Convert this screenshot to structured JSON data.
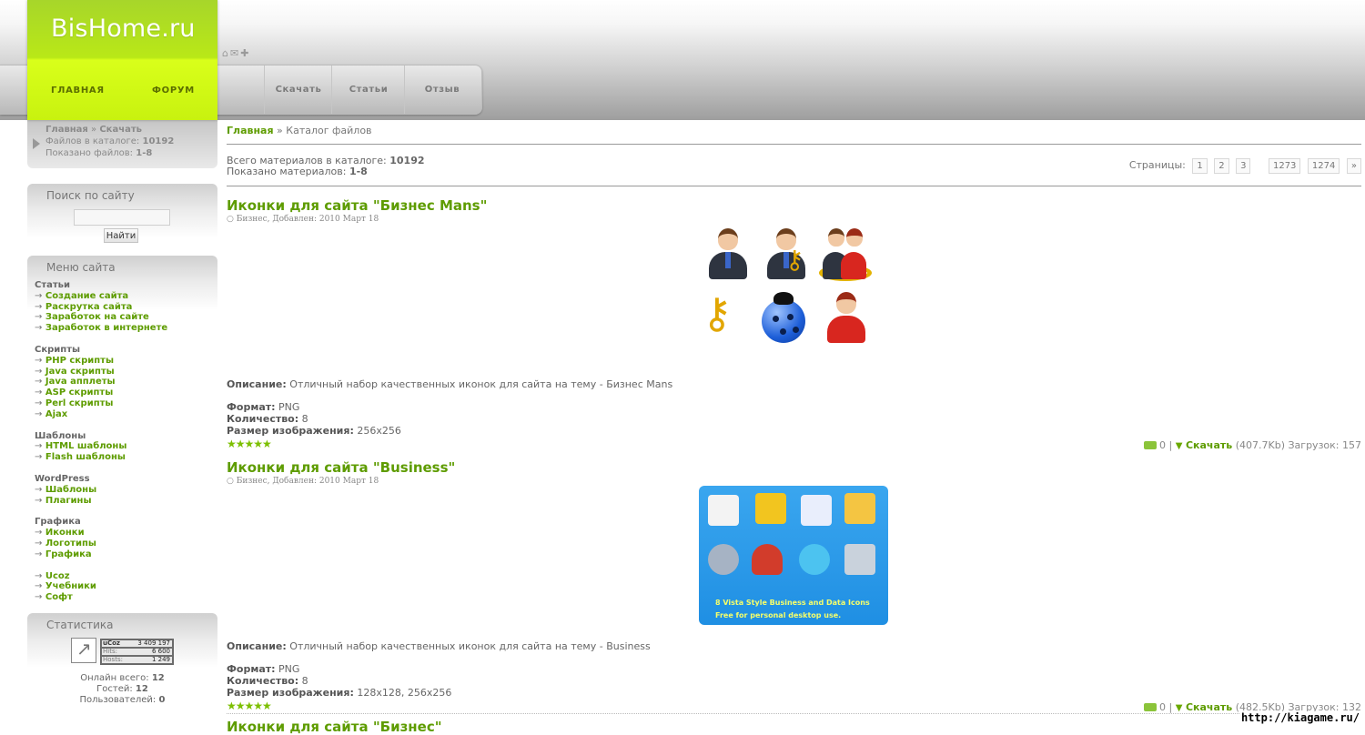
{
  "site": {
    "logo": "BisHome.ru",
    "logo_nav": [
      "ГЛАВНАЯ",
      "ФОРУМ"
    ],
    "quick_icons": [
      "home-icon",
      "mail-icon",
      "add-icon"
    ],
    "nav": [
      "Скачать",
      "Статьи",
      "Отзыв"
    ]
  },
  "crumb_block": {
    "home": "Главная",
    "separator": " » ",
    "current": "Скачать",
    "files_label": "Файлов в каталоге:",
    "files_value": "10192",
    "shown_label": "Показано файлов:",
    "shown_value": "1-8"
  },
  "search": {
    "title": "Поиск по сайту",
    "value": "",
    "button": "Найти"
  },
  "menu": {
    "title": "Меню сайта",
    "groups": [
      {
        "category": "Статьи",
        "items": [
          "Создание сайта",
          "Раскрутка сайта",
          "Заработок на сайте",
          "Заработок в интернете"
        ]
      },
      {
        "category": "Скрипты",
        "items": [
          "PHP скрипты",
          "Java скрипты",
          "Java апплеты",
          "ASP скрипты",
          "Perl скрипты",
          "Ajax"
        ]
      },
      {
        "category": "Шаблоны",
        "items": [
          "HTML шаблоны",
          "Flash шаблоны"
        ]
      },
      {
        "category": "WordPress",
        "items": [
          "Шаблоны",
          "Плагины"
        ]
      },
      {
        "category": "Графика",
        "items": [
          "Иконки",
          "Логотипы",
          "Графика"
        ]
      },
      {
        "category": "",
        "items": [
          "Ucoz",
          "Учебники",
          "Софт"
        ]
      }
    ],
    "arrow": "→"
  },
  "stats": {
    "title": "Статистика",
    "counter": {
      "brand": "uCoz",
      "total": "3 409 197",
      "hits_label": "Hits:",
      "hits": "6 600",
      "hosts_label": "Hosts:",
      "hosts": "1 249"
    },
    "online_label": "Онлайн всего:",
    "online": "12",
    "guests_label": "Гостей:",
    "guests": "12",
    "users_label": "Пользователей:",
    "users": "0"
  },
  "main": {
    "breadcrumb_home": "Главная",
    "breadcrumb_rest": " » Каталог файлов",
    "total_label": "Всего материалов в каталоге:",
    "total_value": "10192",
    "shown_label": "Показано материалов:",
    "shown_value": "1-8",
    "pages_label": "Страницы:",
    "pages": [
      "1",
      "2",
      "3",
      "1273",
      "1274",
      "»"
    ]
  },
  "entries": [
    {
      "title": "Иконки для сайта \"Бизнес Mans\"",
      "meta": "Бизнес, Добавлен: 2010 Март 18",
      "desc_label": "Описание:",
      "desc": "Отличный набор качественных иконок для сайта на тему - Бизнес Mans",
      "format_label": "Формат:",
      "format": "PNG",
      "count_label": "Количество:",
      "count": "8",
      "size_label": "Размер изображения:",
      "size": "256x256",
      "stars": "★★★★★",
      "comments": "0",
      "download_label": "Скачать",
      "filesize": "(407.7Kb)",
      "loads_label": "Загрузок:",
      "loads": "157"
    },
    {
      "title": "Иконки для сайта \"Business\"",
      "meta": "Бизнес, Добавлен: 2010 Март 18",
      "image_caption_1": "8 Vista Style Business and Data Icons",
      "image_caption_2": "Free for personal desktop use.",
      "desc_label": "Описание:",
      "desc": "Отличный набор качественных иконок для сайта на тему - Business",
      "format_label": "Формат:",
      "format": "PNG",
      "count_label": "Количество:",
      "count": "8",
      "size_label": "Размер изображения:",
      "size": "128x128, 256x256",
      "stars": "★★★★★",
      "comments": "0",
      "download_label": "Скачать",
      "filesize": "(482.5Kb)",
      "loads_label": "Загрузок:",
      "loads": "132"
    },
    {
      "title": "Иконки для сайта \"Бизнес\""
    }
  ],
  "watermark": "http://kiagame.ru/",
  "colors": {
    "accent_green": "#5e9c00",
    "logo_green": "#b9e817",
    "blue_image": "#1f8fe3"
  }
}
